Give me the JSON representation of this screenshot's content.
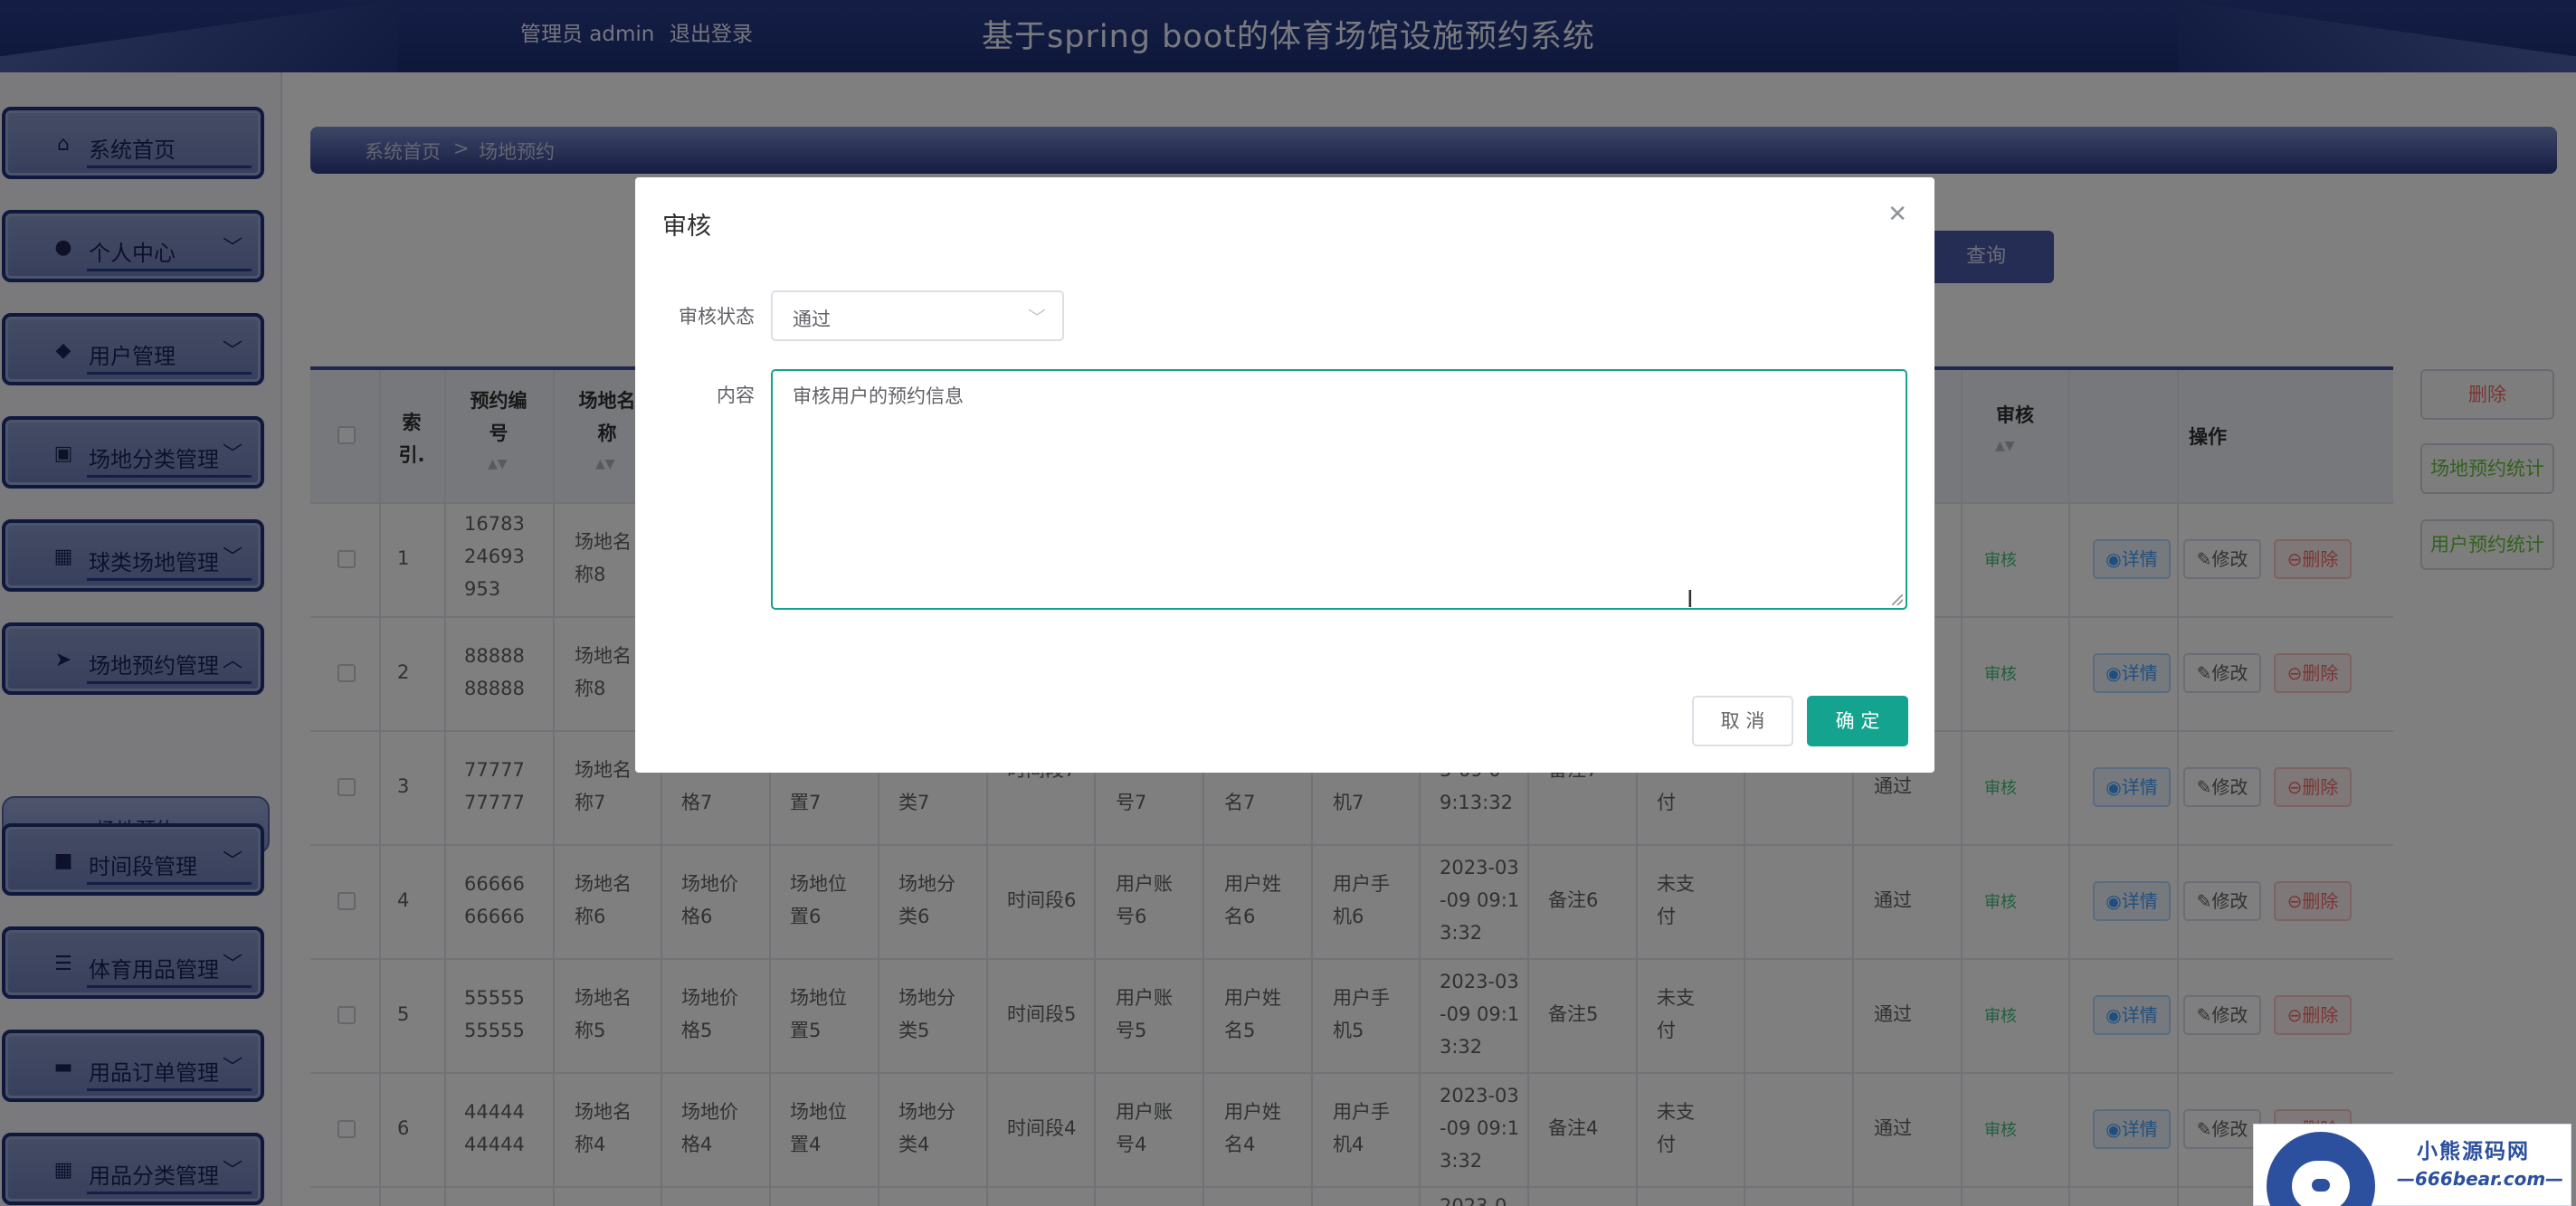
{
  "header": {
    "admin_text": "管理员 admin",
    "logout": "退出登录",
    "title": "基于spring boot的体育场馆设施预约系统"
  },
  "sidebar": {
    "items": [
      {
        "label": "系统首页",
        "icon": "home-icon"
      },
      {
        "label": "个人中心",
        "icon": "user-icon"
      },
      {
        "label": "用户管理",
        "icon": "pin-icon"
      },
      {
        "label": "场地分类管理",
        "icon": "clipboard-icon"
      },
      {
        "label": "球类场地管理",
        "icon": "grid-icon"
      },
      {
        "label": "场地预约管理",
        "icon": "send-icon"
      },
      {
        "label": "时间段管理",
        "icon": "briefcase-icon"
      },
      {
        "label": "体育用品管理",
        "icon": "list-icon"
      },
      {
        "label": "用品订单管理",
        "icon": "book-icon"
      },
      {
        "label": "用品分类管理",
        "icon": "grid-icon"
      }
    ],
    "sub_item": "场地预约"
  },
  "breadcrumb": {
    "home": "系统首页",
    "sep": ">",
    "current": "场地预约"
  },
  "toolbar": {
    "query": "查询"
  },
  "side_buttons": {
    "delete": "删除",
    "venue_stats": "场地预约统计",
    "user_stats": "用户预约统计"
  },
  "table": {
    "headers": {
      "index": "索引.",
      "booking_no": "预约编号",
      "venue_name": "场地名称",
      "audit": "审核",
      "actions": "操作"
    },
    "rows": [
      {
        "index": "1",
        "no": "1678324693953",
        "name": "场地名称8",
        "price": "",
        "location": "",
        "category": "",
        "period": "",
        "account": "",
        "username": "",
        "phone": "",
        "time": "",
        "remark": "",
        "pay": "",
        "status": ""
      },
      {
        "index": "2",
        "no": "8888888888",
        "name": "场地名称8",
        "price": "",
        "location": "",
        "category": "",
        "period": "",
        "account": "",
        "username": "",
        "phone": "",
        "time": "",
        "remark": "",
        "pay": "",
        "status": ""
      },
      {
        "index": "3",
        "no": "7777777777",
        "name": "场地名称7",
        "price": "格7",
        "location": "置7",
        "category": "类7",
        "period": "时间段7",
        "account": "号7",
        "username": "名7",
        "phone": "机7",
        "time": "3-09 0 9:13:32",
        "remark": "备注7",
        "pay": "付",
        "status": "通过"
      },
      {
        "index": "4",
        "no": "6666666666",
        "name": "场地名称6",
        "price": "场地价格6",
        "location": "场地位置6",
        "category": "场地分类6",
        "period": "时间段6",
        "account": "用户账号6",
        "username": "用户姓名6",
        "phone": "用户手机6",
        "time": "2023-03-09 09:13:32",
        "remark": "备注6",
        "pay": "未支付",
        "status": "通过"
      },
      {
        "index": "5",
        "no": "5555555555",
        "name": "场地名称5",
        "price": "场地价格5",
        "location": "场地位置5",
        "category": "场地分类5",
        "period": "时间段5",
        "account": "用户账号5",
        "username": "用户姓名5",
        "phone": "用户手机5",
        "time": "2023-03-09 09:13:32",
        "remark": "备注5",
        "pay": "未支付",
        "status": "通过"
      },
      {
        "index": "6",
        "no": "4444444444",
        "name": "场地名称4",
        "price": "场地价格4",
        "location": "场地位置4",
        "category": "场地分类4",
        "period": "时间段4",
        "account": "用户账号4",
        "username": "用户姓名4",
        "phone": "用户手机4",
        "time": "2023-03-09 09:13:32",
        "remark": "备注4",
        "pay": "未支付",
        "status": "通过"
      }
    ],
    "partial_row_time": "2023-0",
    "audit_tag": "审核",
    "btn_detail": "详情",
    "btn_edit": "修改",
    "btn_delete": "删除"
  },
  "modal": {
    "title": "审核",
    "status_label": "审核状态",
    "status_value": "通过",
    "content_label": "内容",
    "content_value": "审核用户的预约信息",
    "cancel": "取 消",
    "confirm": "确 定"
  },
  "watermark": {
    "line1": "小熊源码网",
    "line2": "—666bear.com—"
  },
  "colors": {
    "primary": "#1c2f74",
    "accent": "#13a38f",
    "danger": "#f56c6c",
    "info": "#409eff"
  }
}
